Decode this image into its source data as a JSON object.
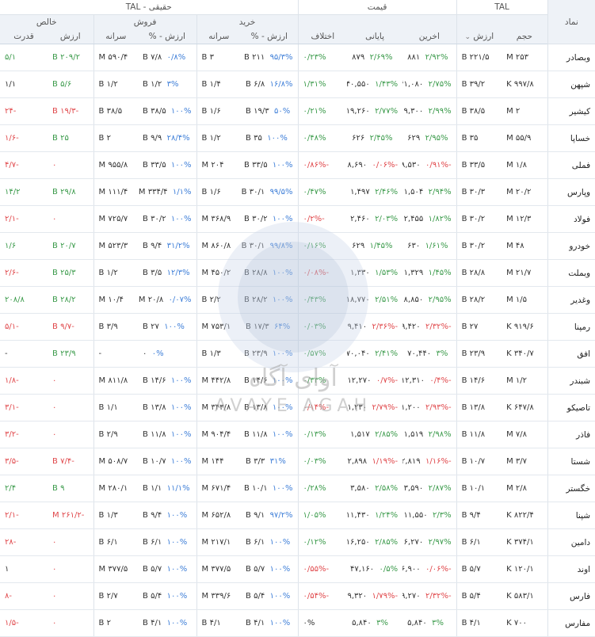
{
  "header": {
    "group_symbol": "نماد",
    "group_tal": "TAL",
    "group_price": "قیمت",
    "group_real": "حقیقی - TAL",
    "sub_buy": "خرید",
    "sub_sell": "فروش",
    "sub_net": "خالص",
    "col_volume": "حجم",
    "col_value": "ارزش",
    "col_last": "اخرین",
    "col_close": "پایانی",
    "col_diff": "اختلاف",
    "col_buy_value_pct": "ارزش - %",
    "col_buy_per_capita": "سرانه",
    "col_sell_value_pct": "ارزش - %",
    "col_sell_per_capita": "سرانه",
    "col_net_value": "ارزش",
    "col_net_power": "قدرت"
  },
  "watermark": {
    "brand_fa": "آوای آگاه",
    "brand_en": "AVAYE AGAH"
  },
  "colors": {
    "positive": "#3a9a4a",
    "negative": "#e0474a",
    "percent_blue": "#3f7fd8"
  },
  "rows": [
    {
      "symbol": "وبصادر",
      "volume": "۲۵۳ M",
      "value": "۲۲۱/۵ B",
      "last": "۸۸۱",
      "last_pct": "۲/۹۲%",
      "last_dir": "g",
      "close": "۸۷۹",
      "close_pct": "۲/۶۹%",
      "close_dir": "g",
      "diff": "۰/۲۳%",
      "diff_dir": "g",
      "buy_val": "۲۱۱ B",
      "buy_pct": "۹۵/۳%",
      "buy_pc": "۳ B",
      "sell_val": "۷/۸ B",
      "sell_pct": "۰/۸%",
      "sell_pc": "۵۹۰/۴ M",
      "net_val": "۲۰۹/۲ B",
      "net_dir": "g",
      "power": "۵/۱",
      "power_dir": "g"
    },
    {
      "symbol": "شپهن",
      "volume": "۹۹۷/۸ K",
      "value": "۳۹/۲ B",
      "last": "۴۱,۰۸۰",
      "last_pct": "۲/۷۵%",
      "last_dir": "g",
      "close": "۴۰,۵۵۰",
      "close_pct": "۱/۴۳%",
      "close_dir": "g",
      "diff": "۱/۳۱%",
      "diff_dir": "g",
      "buy_val": "۶/۸ B",
      "buy_pct": "۱۶/۸%",
      "buy_pc": "۱/۴ B",
      "sell_val": "۱/۲ B",
      "sell_pct": "۳%",
      "sell_pc": "۱/۲ B",
      "net_val": "۵/۶ B",
      "net_dir": "g",
      "power": "۱/۱",
      "power_dir": "k"
    },
    {
      "symbol": "کیشیر",
      "volume": "۲ M",
      "value": "۳۸/۵ B",
      "last": "۱۹,۳۰۰",
      "last_pct": "۲/۹۹%",
      "last_dir": "g",
      "close": "۱۹,۲۶۰",
      "close_pct": "۲/۷۷%",
      "close_dir": "g",
      "diff": "۰/۲۱%",
      "diff_dir": "g",
      "buy_val": "۱۹/۳ B",
      "buy_pct": "۵۰%",
      "buy_pc": "۱/۶ B",
      "sell_val": "۳۸/۵ B",
      "sell_pct": "۱۰۰%",
      "sell_pc": "۳۸/۵ B",
      "net_val": "-۱۹/۳ B",
      "net_dir": "r",
      "power": "-۲۴",
      "power_dir": "r"
    },
    {
      "symbol": "خساپا",
      "volume": "۵۵/۹ M",
      "value": "۳۵ B",
      "last": "۶۲۹",
      "last_pct": "۲/۹۵%",
      "last_dir": "g",
      "close": "۶۲۶",
      "close_pct": "۲/۴۵%",
      "close_dir": "g",
      "diff": "۰/۴۸%",
      "diff_dir": "g",
      "buy_val": "۳۵ B",
      "buy_pct": "۱۰۰%",
      "buy_pc": "۱/۲ B",
      "sell_val": "۹/۹ B",
      "sell_pct": "۲۸/۴%",
      "sell_pc": "۲ B",
      "net_val": "۲۵ B",
      "net_dir": "g",
      "power": "-۱/۶",
      "power_dir": "r"
    },
    {
      "symbol": "فملی",
      "volume": "۱/۸ M",
      "value": "۳۳/۵ B",
      "last": "۱۸,۵۳۰",
      "last_pct": "-۰/۹۱%",
      "last_dir": "r",
      "close": "۱۸,۶۹۰",
      "close_pct": "-۰/۰۶%",
      "close_dir": "r",
      "diff": "-۰/۸۶%",
      "diff_dir": "r",
      "buy_val": "۳۳/۵ B",
      "buy_pct": "۱۰۰%",
      "buy_pc": "۲۰۴ M",
      "sell_val": "۳۳/۵ B",
      "sell_pct": "۱۰۰%",
      "sell_pc": "۹۵۵/۸ M",
      "net_val": "۰",
      "net_dir": "r",
      "power": "-۴/۷",
      "power_dir": "r"
    },
    {
      "symbol": "وپارس",
      "volume": "۲۰/۲ M",
      "value": "۳۰/۳ B",
      "last": "۱,۵۰۴",
      "last_pct": "۲/۹۴%",
      "last_dir": "g",
      "close": "۱,۴۹۷",
      "close_pct": "۲/۴۶%",
      "close_dir": "g",
      "diff": "۰/۴۷%",
      "diff_dir": "g",
      "buy_val": "۳۰/۱ B",
      "buy_pct": "۹۹/۵%",
      "buy_pc": "۱/۶ B",
      "sell_val": "۳۳۴/۴ M",
      "sell_pct": "۱/۱%",
      "sell_pc": "۱۱۱/۴ M",
      "net_val": "۲۹/۸ B",
      "net_dir": "g",
      "power": "۱۴/۲",
      "power_dir": "g"
    },
    {
      "symbol": "فولاد",
      "volume": "۱۲/۳ M",
      "value": "۳۰/۲ B",
      "last": "۲,۴۵۵",
      "last_pct": "۱/۸۲%",
      "last_dir": "g",
      "close": "۲,۴۶۰",
      "close_pct": "۲/۰۳%",
      "close_dir": "g",
      "diff": "-۰/۲%",
      "diff_dir": "r",
      "buy_val": "۳۰/۲ B",
      "buy_pct": "۱۰۰%",
      "buy_pc": "۳۶۸/۹ M",
      "sell_val": "۳۰/۲ B",
      "sell_pct": "۱۰۰%",
      "sell_pc": "۷۲۵/۷ M",
      "net_val": "۰",
      "net_dir": "r",
      "power": "-۲/۱",
      "power_dir": "r"
    },
    {
      "symbol": "خودرو",
      "volume": "۴۸ M",
      "value": "۳۰/۲ B",
      "last": "۶۳۰",
      "last_pct": "۱/۶۱%",
      "last_dir": "g",
      "close": "۶۲۹",
      "close_pct": "۱/۴۵%",
      "close_dir": "g",
      "diff": "۰/۱۶%",
      "diff_dir": "g",
      "buy_val": "۳۰/۱ B",
      "buy_pct": "۹۹/۸%",
      "buy_pc": "۸۶۰/۸ M",
      "sell_val": "۹/۴ B",
      "sell_pct": "۳۱/۲%",
      "sell_pc": "۵۲۳/۳ M",
      "net_val": "۲۰/۷ B",
      "net_dir": "g",
      "power": "۱/۶",
      "power_dir": "g"
    },
    {
      "symbol": "وبملت",
      "volume": "۲۱/۷ M",
      "value": "۲۸/۸ B",
      "last": "۱,۳۲۹",
      "last_pct": "۱/۴۵%",
      "last_dir": "g",
      "close": "۱,۳۳۰",
      "close_pct": "۱/۵۳%",
      "close_dir": "g",
      "diff": "-۰/۰۸%",
      "diff_dir": "r",
      "buy_val": "۲۸/۸ B",
      "buy_pct": "۱۰۰%",
      "buy_pc": "۴۵۰/۲ M",
      "sell_val": "۳/۵ B",
      "sell_pct": "۱۲/۳%",
      "sell_pc": "۱/۲ B",
      "net_val": "۲۵/۳ B",
      "net_dir": "g",
      "power": "-۲/۶",
      "power_dir": "r"
    },
    {
      "symbol": "وغدیر",
      "volume": "۱/۵ M",
      "value": "۲۸/۲ B",
      "last": "۱۸,۸۵۰",
      "last_pct": "۲/۹۵%",
      "last_dir": "g",
      "close": "۱۸,۷۷۰",
      "close_pct": "۲/۵۱%",
      "close_dir": "g",
      "diff": "۰/۴۳%",
      "diff_dir": "g",
      "buy_val": "۲۸/۲ B",
      "buy_pct": "۱۰۰%",
      "buy_pc": "۲/۲ B",
      "sell_val": "۲۰/۸ M",
      "sell_pct": "۰/۰۷%",
      "sell_pc": "۱۰/۴ M",
      "net_val": "۲۸/۲ B",
      "net_dir": "g",
      "power": "۲۰۸/۸",
      "power_dir": "g"
    },
    {
      "symbol": "رمپنا",
      "volume": "۹۱۹/۶ K",
      "value": "۲۷ B",
      "last": "۲۹,۴۲۰",
      "last_pct": "-۲/۳۲%",
      "last_dir": "r",
      "close": "۲۹,۴۱۰",
      "close_pct": "-۲/۳۶%",
      "close_dir": "r",
      "diff": "۰/۰۳%",
      "diff_dir": "g",
      "buy_val": "۱۷/۳ B",
      "buy_pct": "۶۴%",
      "buy_pc": "۷۵۳/۱ M",
      "sell_val": "۲۷ B",
      "sell_pct": "۱۰۰%",
      "sell_pc": "۳/۹ B",
      "net_val": "-۹/۷ B",
      "net_dir": "r",
      "power": "-۵/۱",
      "power_dir": "r"
    },
    {
      "symbol": "افق",
      "volume": "۳۴۰/۷ K",
      "value": "۲۳/۹ B",
      "last": "۷۰,۴۴۰",
      "last_pct": "۳%",
      "last_dir": "g",
      "close": "۷۰,۰۴۰",
      "close_pct": "۲/۴۱%",
      "close_dir": "g",
      "diff": "۰/۵۷%",
      "diff_dir": "g",
      "buy_val": "۲۳/۹ B",
      "buy_pct": "۱۰۰%",
      "buy_pc": "۱/۳ B",
      "sell_val": "۰",
      "sell_pct": "۰%",
      "sell_pc": "-",
      "net_val": "۲۳/۹ B",
      "net_dir": "g",
      "power": "-",
      "power_dir": "k"
    },
    {
      "symbol": "شبندر",
      "volume": "۱/۲ M",
      "value": "۱۴/۶ B",
      "last": "۱۲,۳۱۰",
      "last_pct": "-۰/۴%",
      "last_dir": "r",
      "close": "۱۲,۲۷۰",
      "close_pct": "-۰/۷%",
      "close_dir": "r",
      "diff": "۰/۳۳%",
      "diff_dir": "g",
      "buy_val": "۱۴/۶ B",
      "buy_pct": "۱۰۰%",
      "buy_pc": "۴۴۲/۸ M",
      "sell_val": "۱۴/۶ B",
      "sell_pct": "۱۰۰%",
      "sell_pc": "۸۱۱/۸ M",
      "net_val": "۰",
      "net_dir": "r",
      "power": "-۱/۸",
      "power_dir": "r"
    },
    {
      "symbol": "تاصیکو",
      "volume": "۶۴۷/۸ K",
      "value": "۱۳/۸ B",
      "last": "۲۱,۲۰۰",
      "last_pct": "-۲/۹۳%",
      "last_dir": "r",
      "close": "۲۱,۲۳۰",
      "close_pct": "-۲/۷۹%",
      "close_dir": "r",
      "diff": "-۰/۱۴%",
      "diff_dir": "r",
      "buy_val": "۱۳/۸ B",
      "buy_pct": "۱۰۰%",
      "buy_pc": "۳۴۳/۸ M",
      "sell_val": "۱۳/۸ B",
      "sell_pct": "۱۰۰%",
      "sell_pc": "۱/۱ B",
      "net_val": "۰",
      "net_dir": "r",
      "power": "-۳/۱",
      "power_dir": "r"
    },
    {
      "symbol": "فاذر",
      "volume": "۷/۸ M",
      "value": "۱۱/۸ B",
      "last": "۱,۵۱۹",
      "last_pct": "۲/۹۸%",
      "last_dir": "g",
      "close": "۱,۵۱۷",
      "close_pct": "۲/۸۵%",
      "close_dir": "g",
      "diff": "۰/۱۳%",
      "diff_dir": "g",
      "buy_val": "۱۱/۸ B",
      "buy_pct": "۱۰۰%",
      "buy_pc": "۹۰۴/۴ M",
      "sell_val": "۱۱/۸ B",
      "sell_pct": "۱۰۰%",
      "sell_pc": "۲/۹ B",
      "net_val": "۰",
      "net_dir": "r",
      "power": "-۳/۲",
      "power_dir": "r"
    },
    {
      "symbol": "شستا",
      "volume": "۳/۷ M",
      "value": "۱۰/۷ B",
      "last": "۲,۸۱۹",
      "last_pct": "-۱/۱۶%",
      "last_dir": "r",
      "close": "۲,۸۹۸",
      "close_pct": "-۱/۱۹%",
      "close_dir": "r",
      "diff": "۰/۰۳%",
      "diff_dir": "g",
      "buy_val": "۳/۳ B",
      "buy_pct": "۳۱%",
      "buy_pc": "۱۴۴ M",
      "sell_val": "۱۰/۷ B",
      "sell_pct": "۱۰۰%",
      "sell_pc": "۵۰۸/۷ M",
      "net_val": "-۷/۴ B",
      "net_dir": "r",
      "power": "-۳/۵",
      "power_dir": "r"
    },
    {
      "symbol": "خگستر",
      "volume": "۲/۸ M",
      "value": "۱۰/۱ B",
      "last": "۳,۵۹۰",
      "last_pct": "۲/۸۷%",
      "last_dir": "g",
      "close": "۳,۵۸۰",
      "close_pct": "۲/۵۸%",
      "close_dir": "g",
      "diff": "۰/۲۸%",
      "diff_dir": "g",
      "buy_val": "۱۰/۱ B",
      "buy_pct": "۱۰۰%",
      "buy_pc": "۶۷۱/۴ M",
      "sell_val": "۱/۱ B",
      "sell_pct": "۱۱/۱%",
      "sell_pc": "۲۸۰/۱ M",
      "net_val": "۹ B",
      "net_dir": "g",
      "power": "۲/۴",
      "power_dir": "g"
    },
    {
      "symbol": "شپنا",
      "volume": "۸۲۲/۴ K",
      "value": "۹/۴ B",
      "last": "۱۱,۵۵۰",
      "last_pct": "۲/۳%",
      "last_dir": "g",
      "close": "۱۱,۴۳۰",
      "close_pct": "۱/۲۴%",
      "close_dir": "g",
      "diff": "۱/۰۵%",
      "diff_dir": "g",
      "buy_val": "۹/۱ B",
      "buy_pct": "۹۷/۲%",
      "buy_pc": "۶۵۲/۸ M",
      "sell_val": "۹/۴ B",
      "sell_pct": "۱۰۰%",
      "sell_pc": "۱/۳ B",
      "net_val": "-۲۶۱/۲ M",
      "net_dir": "r",
      "power": "-۲/۱",
      "power_dir": "r"
    },
    {
      "symbol": "دامین",
      "volume": "۳۷۴/۱ K",
      "value": "۶/۱ B",
      "last": "۱۶,۲۷۰",
      "last_pct": "۲/۹۷%",
      "last_dir": "g",
      "close": "۱۶,۲۵۰",
      "close_pct": "۲/۸۵%",
      "close_dir": "g",
      "diff": "۰/۱۲%",
      "diff_dir": "g",
      "buy_val": "۶/۱ B",
      "buy_pct": "۱۰۰%",
      "buy_pc": "۲۱۷/۱ M",
      "sell_val": "۶/۱ B",
      "sell_pct": "۱۰۰%",
      "sell_pc": "۶/۱ B",
      "net_val": "۰",
      "net_dir": "r",
      "power": "-۲۸",
      "power_dir": "r"
    },
    {
      "symbol": "اوند",
      "volume": "۱۲۰/۱ K",
      "value": "۵/۷ B",
      "last": "۴۶,۹۰۰",
      "last_pct": "-۰/۰۶%",
      "last_dir": "r",
      "close": "۴۷,۱۶۰",
      "close_pct": "۰/۵%",
      "close_dir": "g",
      "diff": "-۰/۵۵%",
      "diff_dir": "r",
      "buy_val": "۵/۷ B",
      "buy_pct": "۱۰۰%",
      "buy_pc": "۳۷۷/۵ M",
      "sell_val": "۵/۷ B",
      "sell_pct": "۱۰۰%",
      "sell_pc": "۳۷۷/۵ M",
      "net_val": "۰",
      "net_dir": "r",
      "power": "۱",
      "power_dir": "k"
    },
    {
      "symbol": "فارس",
      "volume": "۵۸۳/۱ K",
      "value": "۵/۴ B",
      "last": "۹,۲۷۰",
      "last_pct": "-۲/۳۲%",
      "last_dir": "r",
      "close": "۹,۳۲۰",
      "close_pct": "-۱/۷۹%",
      "close_dir": "r",
      "diff": "-۰/۵۴%",
      "diff_dir": "r",
      "buy_val": "۵/۴ B",
      "buy_pct": "۱۰۰%",
      "buy_pc": "۳۳۹/۶ M",
      "sell_val": "۵/۴ B",
      "sell_pct": "۱۰۰%",
      "sell_pc": "۲/۷ B",
      "net_val": "۰",
      "net_dir": "r",
      "power": "-۸",
      "power_dir": "r"
    },
    {
      "symbol": "مفارس",
      "volume": "۷۰۰ K",
      "value": "۴/۱ B",
      "last": "۵,۸۴۰",
      "last_pct": "۳%",
      "last_dir": "g",
      "close": "۵,۸۴۰",
      "close_pct": "۳%",
      "close_dir": "g",
      "diff": "۰%",
      "diff_dir": "k",
      "buy_val": "۴/۱ B",
      "buy_pct": "۱۰۰%",
      "buy_pc": "۴/۱ B",
      "sell_val": "۴/۱ B",
      "sell_pct": "۱۰۰%",
      "sell_pc": "۲ B",
      "net_val": "۰",
      "net_dir": "r",
      "power": "-۱/۵",
      "power_dir": "r"
    }
  ]
}
